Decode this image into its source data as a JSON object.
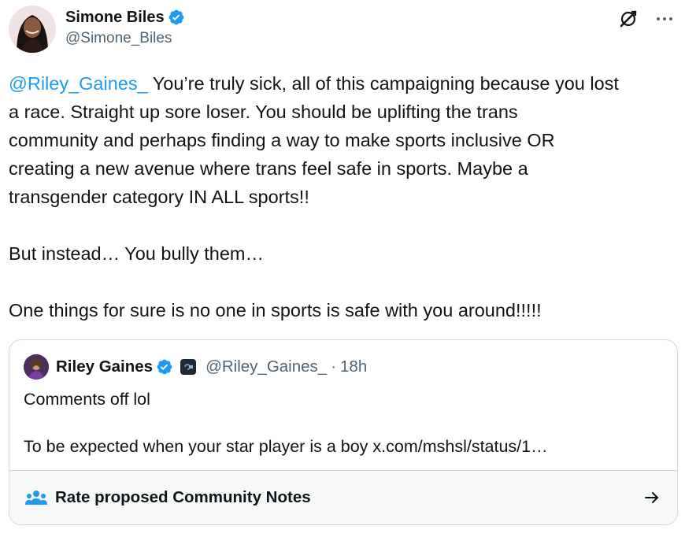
{
  "tweet": {
    "author_name": "Simone Biles",
    "author_handle": "@Simone_Biles",
    "mention": "@Riley_Gaines_",
    "text_line1_rest": " You’re truly sick, all of this campaigning because you lost",
    "text_line2": "a race. Straight up sore loser. You should be uplifting the trans",
    "text_line3": "community and perhaps finding a way to make sports inclusive OR",
    "text_line4": "creating a new avenue where trans feel safe in sports. Maybe a",
    "text_line5": "transgender category IN ALL sports!!",
    "paragraph2": "But instead… You bully them…",
    "paragraph3": "One things for sure is no one in sports is safe with you around!!!!!"
  },
  "quote": {
    "author_name": "Riley Gaines",
    "author_handle": "@Riley_Gaines_",
    "separator": "·",
    "time": "18h",
    "line1": "Comments off lol",
    "line2": "To be expected when your star player is a boy x.com/mshsl/status/1…",
    "notes_label": "Rate proposed Community Notes"
  },
  "icons": {
    "verified": "verified-badge-icon",
    "grok": "grok-icon",
    "more": "more-icon",
    "affiliate": "affiliate-badge-icon",
    "community_notes": "people-icon",
    "arrow": "arrow-right-icon"
  },
  "colors": {
    "accent": "#1d9bf0",
    "text": "#0f1419",
    "secondary": "#536471",
    "border": "#cfd9de",
    "notes_bg": "#f7f9f9"
  }
}
